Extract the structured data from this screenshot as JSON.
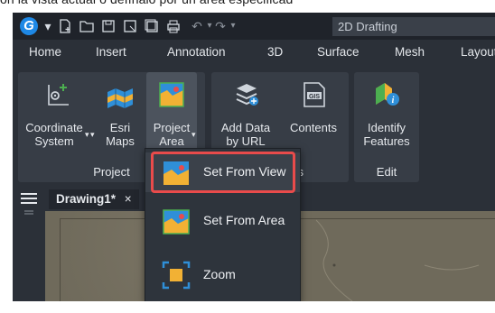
{
  "top_text": "on la vista actual o defínalo por un área especificad",
  "titlebar": {
    "logo_letter": "G",
    "workspace": "2D Drafting",
    "quick_access": [
      "new-icon",
      "open-icon",
      "save-icon",
      "save-as-icon",
      "save-all-icon",
      "print-icon",
      "undo-icon",
      "redo-icon"
    ]
  },
  "tabs": [
    "Home",
    "Insert",
    "Annotation",
    "3D",
    "Surface",
    "Mesh",
    "Layout"
  ],
  "ribbon": {
    "groups": [
      {
        "label": "Project",
        "buttons": [
          {
            "label": [
              "Coordinate",
              "System"
            ],
            "icon": "coordinate-system-icon",
            "has_dropdown": true
          },
          {
            "label": [
              "Esri",
              "Maps"
            ],
            "icon": "esri-maps-icon",
            "has_dropdown": true
          },
          {
            "label": [
              "Project",
              "Area"
            ],
            "icon": "project-area-icon",
            "has_dropdown": true
          }
        ]
      },
      {
        "label": "Contents",
        "buttons": [
          {
            "label": [
              "Add Data",
              "by URL"
            ],
            "icon": "add-data-url-icon"
          },
          {
            "label": [
              "Contents"
            ],
            "icon": "gis-contents-icon"
          }
        ]
      },
      {
        "label": "Edit",
        "buttons": [
          {
            "label": [
              "Identify",
              "Features"
            ],
            "icon": "identify-features-icon"
          }
        ]
      }
    ]
  },
  "document": {
    "tab": "Drawing1*",
    "close": "×"
  },
  "dropdown": {
    "items": [
      {
        "label": "Set From View",
        "icon": "set-from-view-icon",
        "selected": true
      },
      {
        "label": "Set From Area",
        "icon": "set-from-area-icon",
        "selected": false
      },
      {
        "label": "Zoom",
        "icon": "zoom-icon",
        "selected": false
      }
    ]
  },
  "colors": {
    "accent_outline": "#e94b4b",
    "logo": "#1e88e5",
    "ribbon_bg": "#2b3038",
    "group_bg": "#373d46"
  }
}
